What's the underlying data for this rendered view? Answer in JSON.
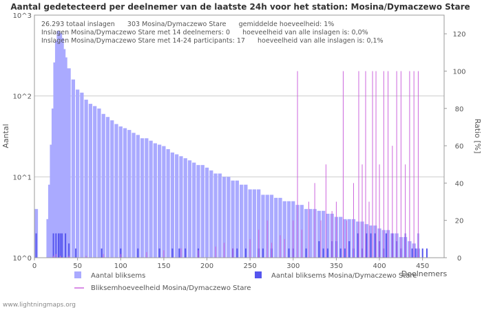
{
  "chart_data": {
    "type": "bar",
    "title": "Aantal gedetecteerd per deelnemer van de laatste 24h voor het station: Mosina/Dymaczewo Stare",
    "xlabel": "Deelnemers",
    "ylabel": "Aantal",
    "y2label": "Ratio [%]",
    "x_ticks": [
      0,
      50,
      100,
      150,
      200,
      250,
      300,
      350,
      400,
      450
    ],
    "x_range": [
      0,
      475
    ],
    "y_scale": "log",
    "y_range": [
      1,
      1000
    ],
    "y_ticks": [
      "10^0",
      "10^1",
      "10^2",
      "10^3"
    ],
    "y2_ticks": [
      0,
      20,
      40,
      60,
      80,
      100,
      120
    ],
    "y2_range": [
      0,
      130
    ],
    "info_lines": [
      "26.293 totaal inslagen      303 Mosina/Dymaczewo Stare      gemiddelde hoeveelheid: 1%",
      "Inslagen Mosina/Dymaczewo Stare met 14 deelnemers: 0      hoeveelheid van alle inslagen is: 0,0%",
      "Inslagen Mosina/Dymaczewo Stare met 14-24 participants: 17      hoeveelheid van alle inslagen is: 0,1%"
    ],
    "legend": {
      "total": "Aantal bliksems",
      "station": "Aantal bliksems Mosina/Dymaczewo Stare",
      "ratio": "Bliksemhoeveelheid Mosina/Dymaczewo Stare"
    },
    "colors": {
      "total": "#aaaaff",
      "station": "#5555ee",
      "ratio": "#cc66dd",
      "grid": "#cccccc"
    },
    "watermark": "www.lightningmaps.org",
    "series": [
      {
        "name": "Aantal bliksems",
        "values": [
          [
            2,
            4
          ],
          [
            16,
            3
          ],
          [
            18,
            8
          ],
          [
            20,
            25
          ],
          [
            22,
            70
          ],
          [
            24,
            260
          ],
          [
            26,
            480
          ],
          [
            28,
            640
          ],
          [
            30,
            600
          ],
          [
            32,
            520
          ],
          [
            34,
            380
          ],
          [
            36,
            300
          ],
          [
            40,
            220
          ],
          [
            45,
            160
          ],
          [
            50,
            120
          ],
          [
            55,
            110
          ],
          [
            60,
            90
          ],
          [
            65,
            80
          ],
          [
            70,
            75
          ],
          [
            75,
            70
          ],
          [
            80,
            60
          ],
          [
            85,
            55
          ],
          [
            90,
            50
          ],
          [
            95,
            45
          ],
          [
            100,
            42
          ],
          [
            105,
            40
          ],
          [
            110,
            38
          ],
          [
            115,
            35
          ],
          [
            120,
            33
          ],
          [
            125,
            30
          ],
          [
            130,
            30
          ],
          [
            135,
            28
          ],
          [
            140,
            26
          ],
          [
            145,
            25
          ],
          [
            150,
            24
          ],
          [
            155,
            22
          ],
          [
            160,
            20
          ],
          [
            165,
            19
          ],
          [
            170,
            18
          ],
          [
            175,
            17
          ],
          [
            180,
            16
          ],
          [
            185,
            15
          ],
          [
            190,
            14
          ],
          [
            195,
            14
          ],
          [
            200,
            13
          ],
          [
            205,
            12
          ],
          [
            210,
            11
          ],
          [
            215,
            11
          ],
          [
            220,
            10
          ],
          [
            225,
            10
          ],
          [
            230,
            9
          ],
          [
            235,
            9
          ],
          [
            240,
            8
          ],
          [
            245,
            8
          ],
          [
            250,
            7
          ],
          [
            255,
            7
          ],
          [
            260,
            7
          ],
          [
            265,
            6
          ],
          [
            270,
            6
          ],
          [
            275,
            6
          ],
          [
            280,
            5.5
          ],
          [
            285,
            5.5
          ],
          [
            290,
            5
          ],
          [
            295,
            5
          ],
          [
            300,
            5
          ],
          [
            305,
            4.5
          ],
          [
            310,
            4.5
          ],
          [
            315,
            4
          ],
          [
            320,
            4
          ],
          [
            325,
            4
          ],
          [
            330,
            3.8
          ],
          [
            335,
            3.8
          ],
          [
            340,
            3.5
          ],
          [
            345,
            3.5
          ],
          [
            350,
            3.2
          ],
          [
            355,
            3.2
          ],
          [
            360,
            3
          ],
          [
            365,
            3
          ],
          [
            370,
            3
          ],
          [
            375,
            2.8
          ],
          [
            380,
            2.8
          ],
          [
            385,
            2.6
          ],
          [
            390,
            2.5
          ],
          [
            395,
            2.5
          ],
          [
            400,
            2.3
          ],
          [
            405,
            2.2
          ],
          [
            410,
            2.2
          ],
          [
            415,
            2
          ],
          [
            420,
            2
          ],
          [
            425,
            1.8
          ],
          [
            430,
            1.8
          ],
          [
            435,
            1.6
          ],
          [
            440,
            1.5
          ],
          [
            445,
            1.3
          ]
        ]
      },
      {
        "name": "Aantal bliksems Mosina/Dymaczewo Stare",
        "values": [
          [
            2,
            2
          ],
          [
            22,
            2
          ],
          [
            25,
            2
          ],
          [
            28,
            2
          ],
          [
            30,
            2
          ],
          [
            32,
            2
          ],
          [
            36,
            2
          ],
          [
            40,
            1.5
          ],
          [
            48,
            1.3
          ],
          [
            78,
            1.3
          ],
          [
            100,
            1.3
          ],
          [
            120,
            1.3
          ],
          [
            145,
            1.3
          ],
          [
            160,
            1.3
          ],
          [
            168,
            1.3
          ],
          [
            175,
            1.3
          ],
          [
            190,
            1.3
          ],
          [
            230,
            1.3
          ],
          [
            235,
            1.3
          ],
          [
            245,
            1.3
          ],
          [
            260,
            1.3
          ],
          [
            265,
            1.3
          ],
          [
            275,
            1.3
          ],
          [
            295,
            1.3
          ],
          [
            300,
            1.3
          ],
          [
            315,
            1.3
          ],
          [
            330,
            1.6
          ],
          [
            335,
            1.3
          ],
          [
            340,
            1.3
          ],
          [
            345,
            1.6
          ],
          [
            350,
            1.6
          ],
          [
            355,
            1.3
          ],
          [
            360,
            1.3
          ],
          [
            365,
            1.6
          ],
          [
            370,
            1.3
          ],
          [
            375,
            2
          ],
          [
            380,
            1.3
          ],
          [
            385,
            2
          ],
          [
            390,
            2
          ],
          [
            395,
            2
          ],
          [
            400,
            1.6
          ],
          [
            405,
            1.3
          ],
          [
            408,
            2
          ],
          [
            415,
            2
          ],
          [
            420,
            1.6
          ],
          [
            425,
            1.3
          ],
          [
            430,
            2
          ],
          [
            438,
            1.3
          ],
          [
            442,
            1.3
          ],
          [
            445,
            2
          ],
          [
            450,
            1.3
          ],
          [
            455,
            1.3
          ]
        ]
      },
      {
        "name": "Bliksemhoeveelheid Mosina/Dymaczewo Stare",
        "values": [
          [
            22,
            1
          ],
          [
            25,
            2
          ],
          [
            30,
            1
          ],
          [
            40,
            1
          ],
          [
            60,
            1
          ],
          [
            80,
            2
          ],
          [
            100,
            2
          ],
          [
            130,
            3
          ],
          [
            150,
            4
          ],
          [
            170,
            5
          ],
          [
            190,
            4
          ],
          [
            210,
            6
          ],
          [
            220,
            8
          ],
          [
            230,
            5
          ],
          [
            250,
            10
          ],
          [
            260,
            15
          ],
          [
            270,
            20
          ],
          [
            275,
            8
          ],
          [
            285,
            12
          ],
          [
            290,
            10
          ],
          [
            300,
            20
          ],
          [
            305,
            100
          ],
          [
            310,
            15
          ],
          [
            318,
            30
          ],
          [
            325,
            40
          ],
          [
            332,
            20
          ],
          [
            338,
            50
          ],
          [
            345,
            25
          ],
          [
            350,
            30
          ],
          [
            358,
            100
          ],
          [
            362,
            20
          ],
          [
            370,
            40
          ],
          [
            376,
            100
          ],
          [
            380,
            50
          ],
          [
            384,
            100
          ],
          [
            388,
            30
          ],
          [
            392,
            100
          ],
          [
            396,
            100
          ],
          [
            400,
            50
          ],
          [
            405,
            100
          ],
          [
            410,
            100
          ],
          [
            415,
            60
          ],
          [
            420,
            100
          ],
          [
            425,
            100
          ],
          [
            430,
            50
          ],
          [
            435,
            100
          ],
          [
            440,
            100
          ],
          [
            445,
            100
          ]
        ]
      }
    ]
  }
}
